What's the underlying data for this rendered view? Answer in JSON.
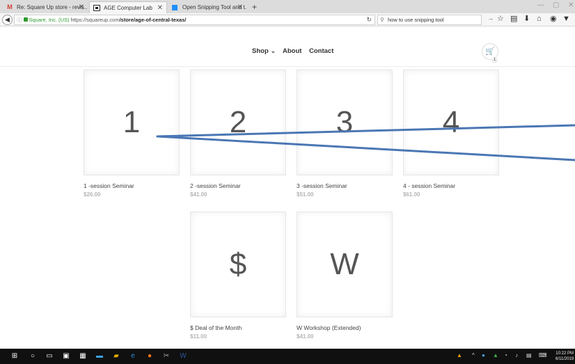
{
  "browser": {
    "tabs": [
      {
        "label": "Re: Square Up store - revis...",
        "icon": "gmail-icon"
      },
      {
        "label": "AGE Computer Lab",
        "icon": "square-icon"
      },
      {
        "label": "Open Snipping Tool and t...",
        "icon": "ms-icon"
      }
    ],
    "close_glyph": "✕",
    "new_tab_glyph": "+",
    "url": {
      "org": "Square, Inc. (US)",
      "host": "https://squareup.com",
      "path": "/store/age-of-central-texas/"
    },
    "search_value": "how to use snipping tool"
  },
  "site": {
    "nav": {
      "shop": "Shop ⌄",
      "about": "About",
      "contact": "Contact"
    },
    "cart_count": "1"
  },
  "products": [
    {
      "glyph": "1",
      "name": "1 -session Seminar",
      "price": "$26.00"
    },
    {
      "glyph": "2",
      "name": "2 -session Seminar",
      "price": "$41.00"
    },
    {
      "glyph": "3",
      "name": "3 -session Seminar",
      "price": "$51.00"
    },
    {
      "glyph": "4",
      "name": "4 - session Seminar",
      "price": "$61.00"
    },
    {
      "glyph": "$",
      "name": "$ Deal of the Month",
      "price": "$11.00"
    },
    {
      "glyph": "W",
      "name": "W Workshop (Extended)",
      "price": "$41.00"
    }
  ],
  "taskbar": {
    "clock_time": "10:22 PM",
    "clock_date": "6/11/2019"
  },
  "colors": {
    "annotation": "#4a77b4",
    "price": "#b5b5b5",
    "secure": "#2e9a2e"
  }
}
